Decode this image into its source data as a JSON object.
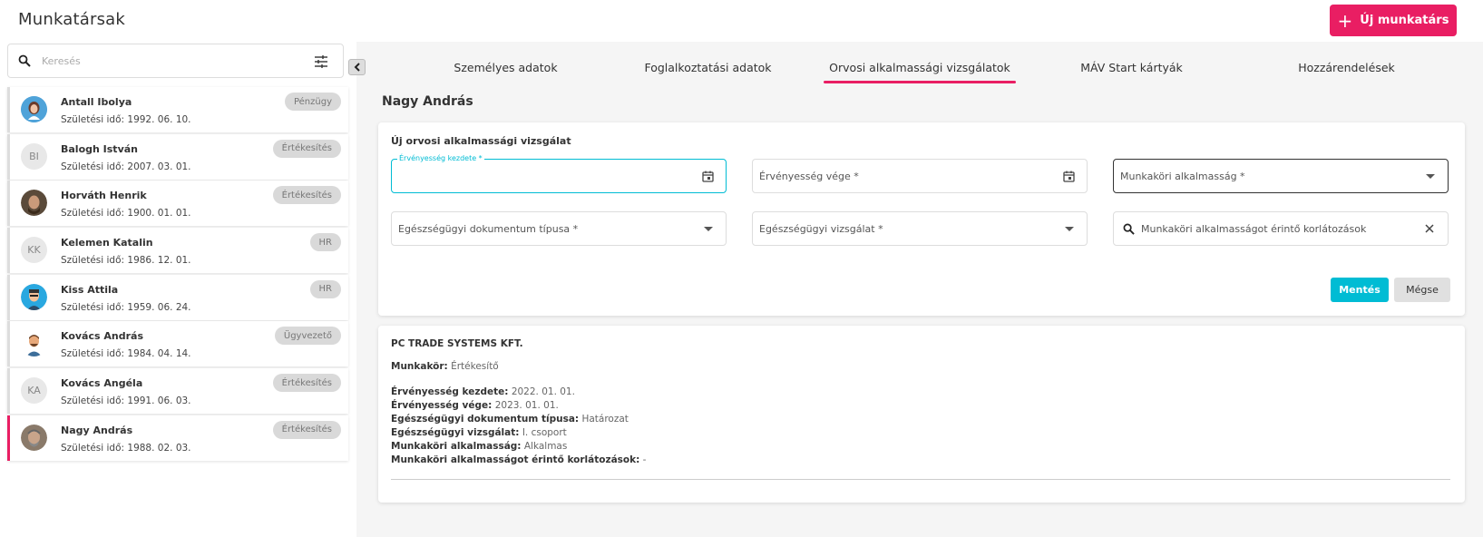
{
  "header": {
    "title": "Munkatársak",
    "new_button": "Új munkatárs"
  },
  "search": {
    "placeholder": "Keresés"
  },
  "employees": [
    {
      "name": "Antall Ibolya",
      "dob": "Születési idő: 1992. 06. 10.",
      "dept": "Pénzügy",
      "avatar": "photo"
    },
    {
      "name": "Balogh István",
      "dob": "Születési idő: 2007. 03. 01.",
      "dept": "Értékesítés",
      "avatar": "BI"
    },
    {
      "name": "Horváth Henrik",
      "dob": "Születési idő: 1900. 01. 01.",
      "dept": "Értékesítés",
      "avatar": "photo"
    },
    {
      "name": "Kelemen Katalin",
      "dob": "Születési idő: 1986. 12. 01.",
      "dept": "HR",
      "avatar": "KK"
    },
    {
      "name": "Kiss Attila",
      "dob": "Születési idő: 1959. 06. 24.",
      "dept": "HR",
      "avatar": "photo"
    },
    {
      "name": "Kovács András",
      "dob": "Születési idő: 1984. 04. 14.",
      "dept": "Ügyvezető",
      "avatar": "photo"
    },
    {
      "name": "Kovács Angéla",
      "dob": "Születési idő: 1991. 06. 03.",
      "dept": "Értékesítés",
      "avatar": "KA"
    },
    {
      "name": "Nagy András",
      "dob": "Születési idő: 1988. 02. 03.",
      "dept": "Értékesítés",
      "avatar": "photo",
      "active": true
    }
  ],
  "tabs": [
    {
      "label": "Személyes adatok"
    },
    {
      "label": "Foglalkoztatási adatok"
    },
    {
      "label": "Orvosi alkalmassági vizsgálatok",
      "active": true
    },
    {
      "label": "MÁV Start kártyák"
    },
    {
      "label": "Hozzárendelések"
    }
  ],
  "person_name": "Nagy András",
  "form": {
    "title": "Új orvosi alkalmassági vizsgálat",
    "valid_from_label": "Érvényesség kezdete *",
    "valid_to_label": "Érvényesség vége *",
    "fitness_label": "Munkaköri alkalmasság *",
    "doc_type_label": "Egészségügyi dokumentum típusa *",
    "exam_label": "Egészségügyi vizsgálat *",
    "restrictions_label": "Munkaköri alkalmasságot érintő korlátozások",
    "save": "Mentés",
    "cancel": "Mégse"
  },
  "record": {
    "company": "PC TRADE SYSTEMS KFT.",
    "job_label": "Munkakör:",
    "job_value": "Értékesítő",
    "valid_from_label": "Érvényesség kezdete:",
    "valid_from_value": "2022. 01. 01.",
    "valid_to_label": "Érvényesség vége:",
    "valid_to_value": "2023. 01. 01.",
    "doc_type_label": "Egészségügyi dokumentum típusa:",
    "doc_type_value": "Határozat",
    "exam_label": "Egészségügyi vizsgálat:",
    "exam_value": "I. csoport",
    "fitness_label": "Munkaköri alkalmasság:",
    "fitness_value": "Alkalmas",
    "restrictions_label": "Munkaköri alkalmasságot érintő korlátozások:",
    "restrictions_value": "-"
  },
  "colors": {
    "accent": "#e91e63",
    "primary": "#00bcd4"
  }
}
